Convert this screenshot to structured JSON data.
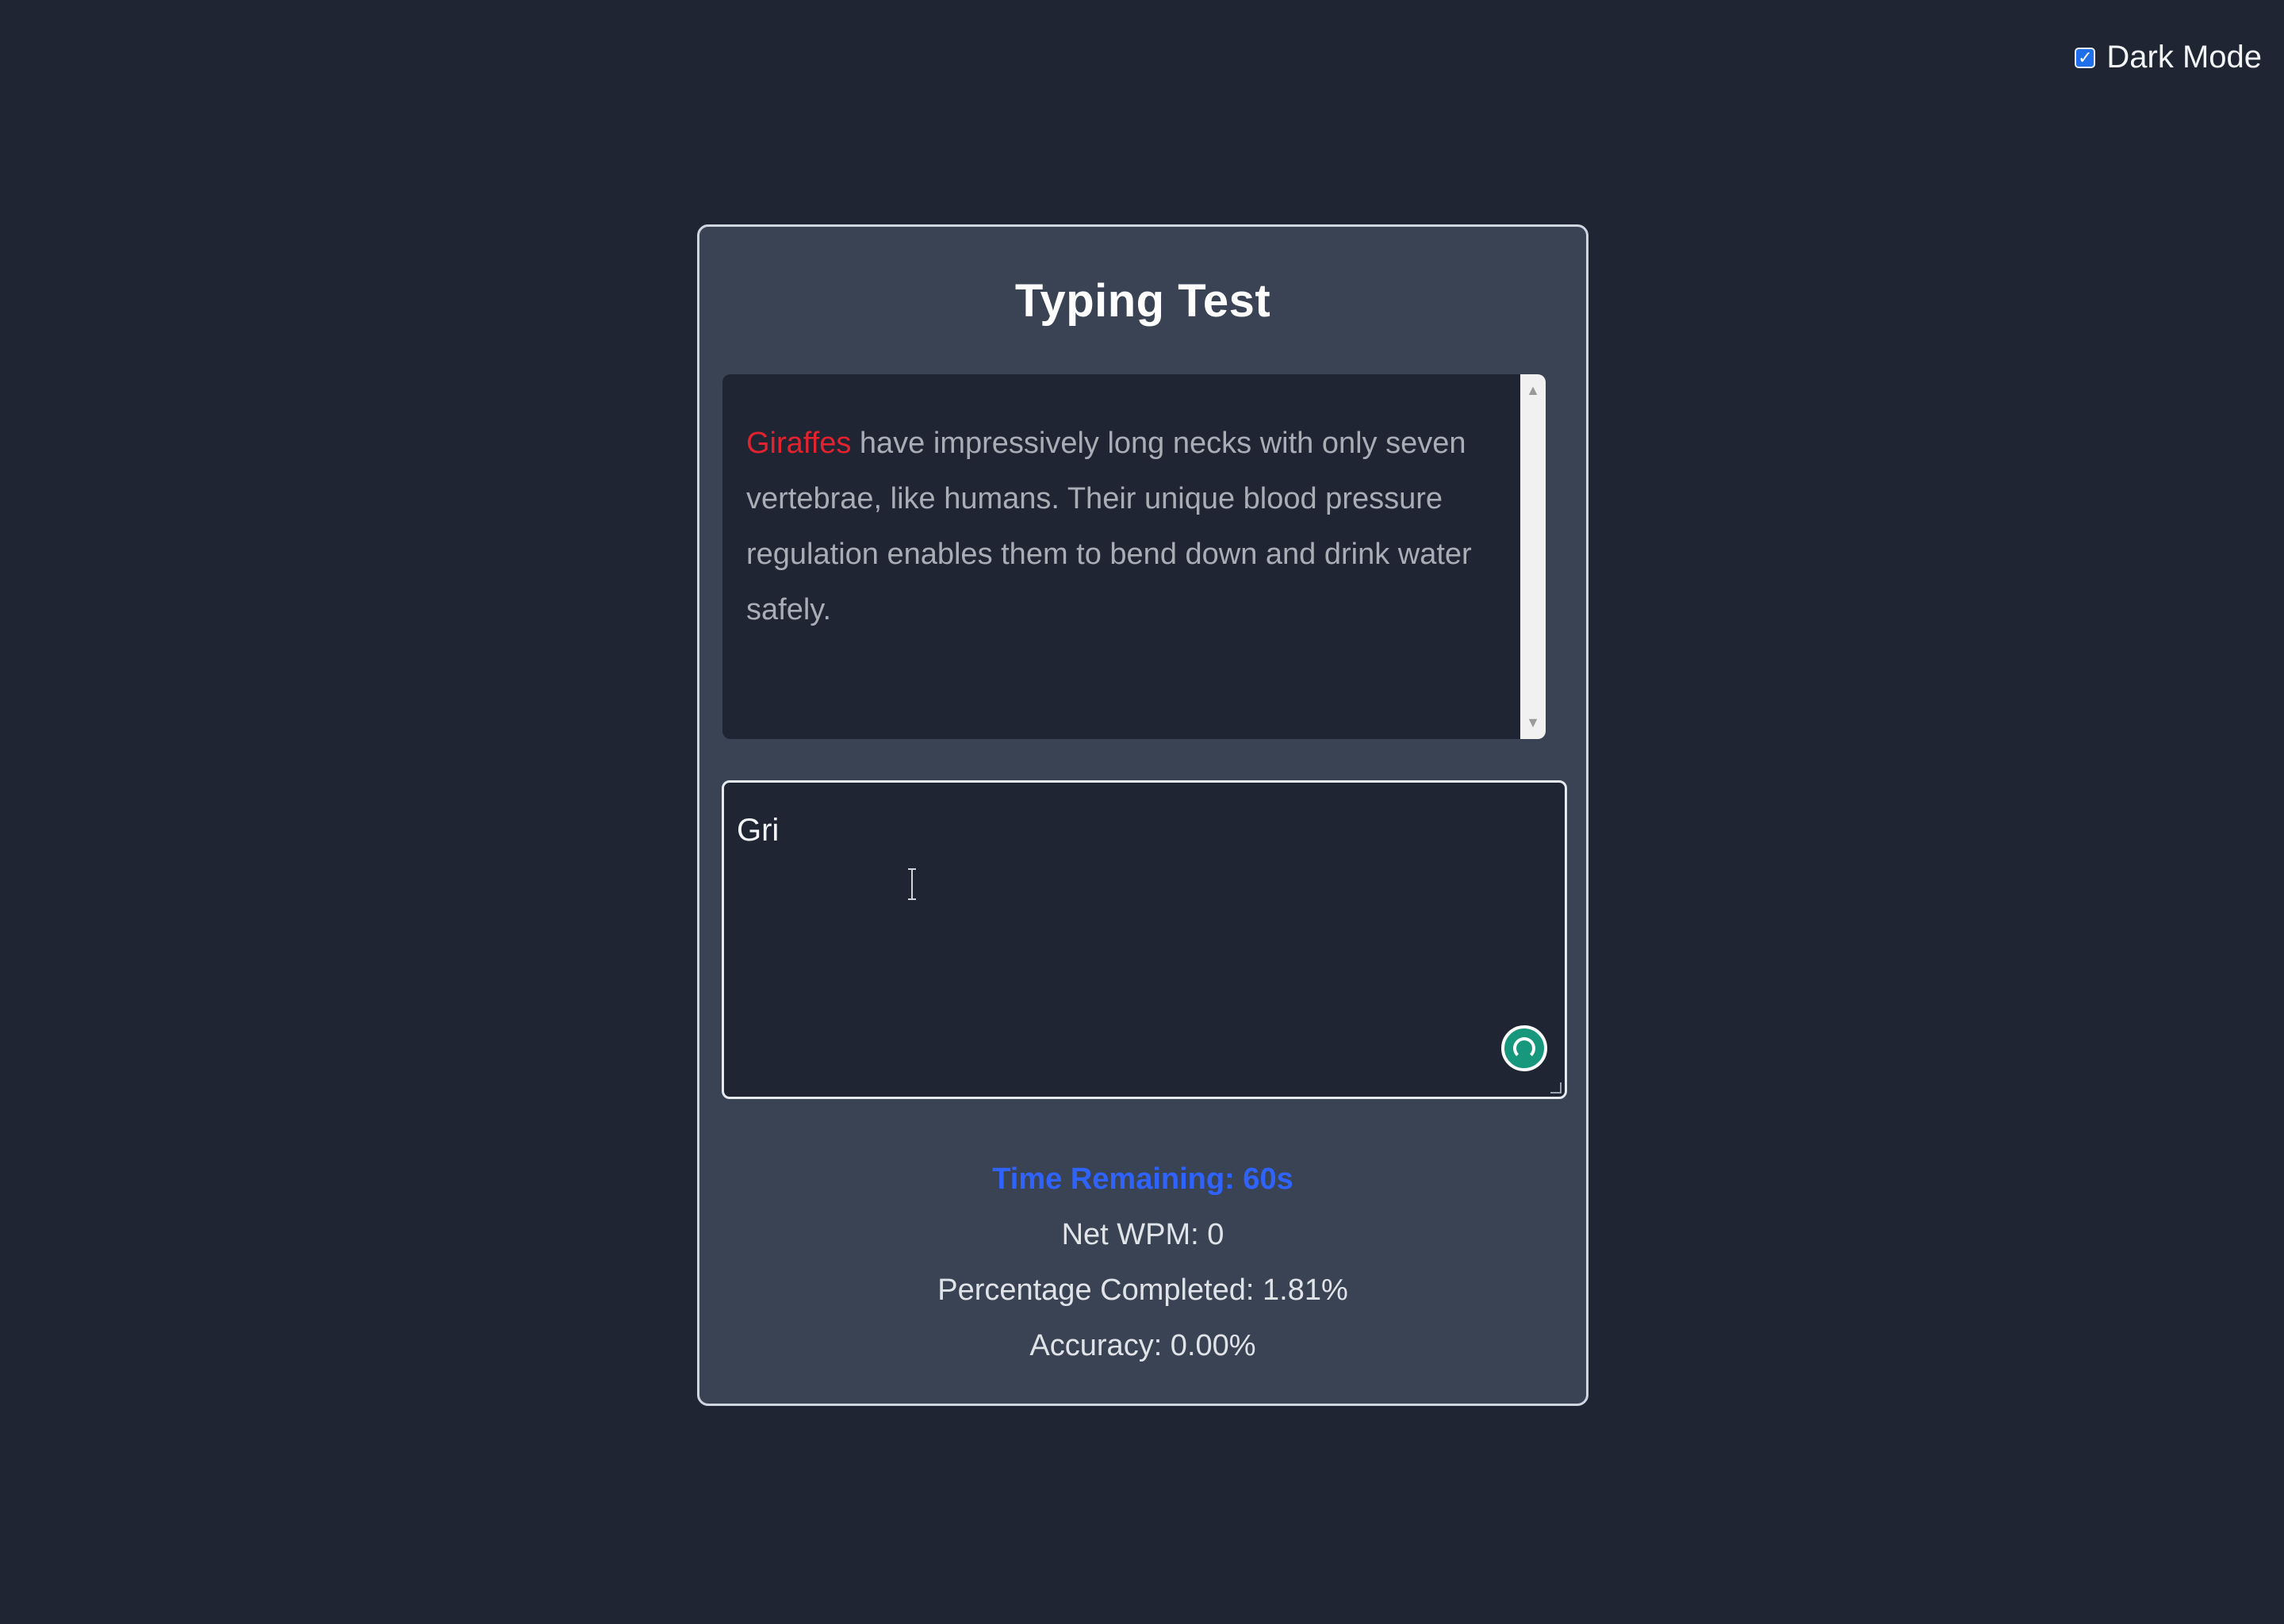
{
  "theme": {
    "accent": "#2f63ff",
    "background": "#1f2532",
    "card": "#3a4354",
    "highlight": "#e3222f",
    "assistant_button": "#17977b"
  },
  "header": {
    "dark_mode_label": "Dark Mode",
    "dark_mode_checked": true
  },
  "app": {
    "title": "Typing Test"
  },
  "passage": {
    "current_word": "Giraffes",
    "rest_text": " have impressively long necks with only seven vertebrae, like humans. Their unique blood pressure regulation enables them to bend down and drink water safely."
  },
  "input": {
    "value": "Gri"
  },
  "stats": {
    "time_remaining": "Time Remaining: 60s",
    "net_wpm": "Net WPM: 0",
    "percentage_completed": "Percentage Completed: 1.81%",
    "accuracy": "Accuracy: 0.00%"
  },
  "icons": {
    "checkbox": "check-icon",
    "assistant": "assistant-icon",
    "cursor": "text-cursor-icon"
  }
}
